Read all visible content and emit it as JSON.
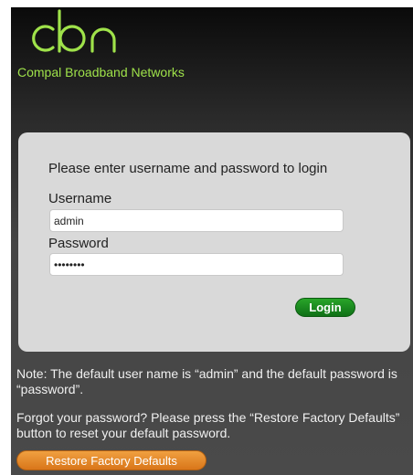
{
  "logo": {
    "icon": "cbn-logo-icon",
    "color": "#9fe24a"
  },
  "brand": {
    "name": "Compal Broadband Networks"
  },
  "login": {
    "prompt": "Please enter username and password to login",
    "username_label": "Username",
    "username_value": "admin",
    "password_label": "Password",
    "password_value": "password",
    "login_button": "Login"
  },
  "notes": {
    "default_credentials": "Note: The default user name is “admin” and the default password is “password”.",
    "forgot": "Forgot your password? Please press the “Restore Factory Defaults” button to reset your default password."
  },
  "restore_button": "Restore Factory Defaults",
  "colors": {
    "brand_green": "#9fe24a",
    "login_button": "#1a8a1f",
    "restore_button": "#e58a2a",
    "panel": "#d9d9d9"
  }
}
